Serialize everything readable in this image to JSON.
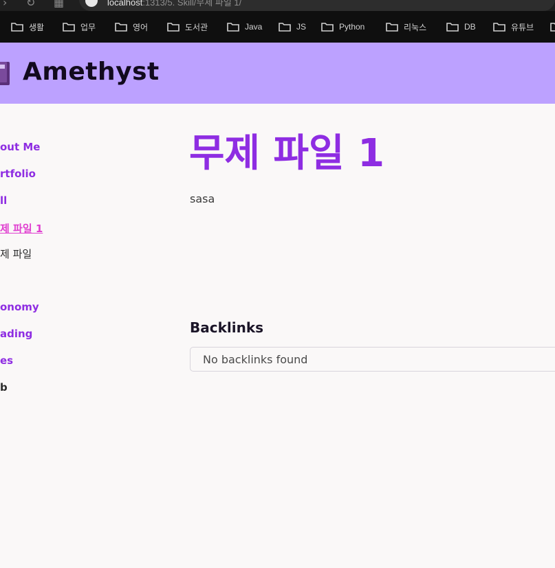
{
  "browser": {
    "url_host": "localhost",
    "url_path": ":1313/5. Skill/무제 파일 1/"
  },
  "bookmarks": [
    {
      "label": "생활"
    },
    {
      "label": "업무"
    },
    {
      "label": "영어"
    },
    {
      "label": "도서관"
    },
    {
      "label": "Java"
    },
    {
      "label": "JS"
    },
    {
      "label": "Python"
    },
    {
      "label": "리눅스"
    },
    {
      "label": "DB"
    },
    {
      "label": "유튜브"
    }
  ],
  "site": {
    "title": "Amethyst",
    "logo_icon": "book-icon"
  },
  "sidebar": {
    "items": [
      {
        "label": "out Me",
        "state": "link"
      },
      {
        "label": "rtfolio",
        "state": "link"
      },
      {
        "label": "ll",
        "state": "link"
      },
      {
        "label": "제 파일 1",
        "state": "active"
      },
      {
        "label": "제 파일",
        "state": "plain"
      },
      {
        "label": "onomy",
        "state": "link"
      },
      {
        "label": "ading",
        "state": "link"
      },
      {
        "label": "es",
        "state": "link"
      },
      {
        "label": "b",
        "state": "plain"
      }
    ]
  },
  "main": {
    "title": "무제 파일 1",
    "body": "sasa",
    "backlinks_heading": "Backlinks",
    "backlinks_empty": "No backlinks found"
  },
  "colors": {
    "header_bg": "#bca1ff",
    "accent": "#8e2de2",
    "active_link": "#e040d0",
    "page_bg": "#faf8f8",
    "bookmarks_bg": "#0f0f0f"
  }
}
